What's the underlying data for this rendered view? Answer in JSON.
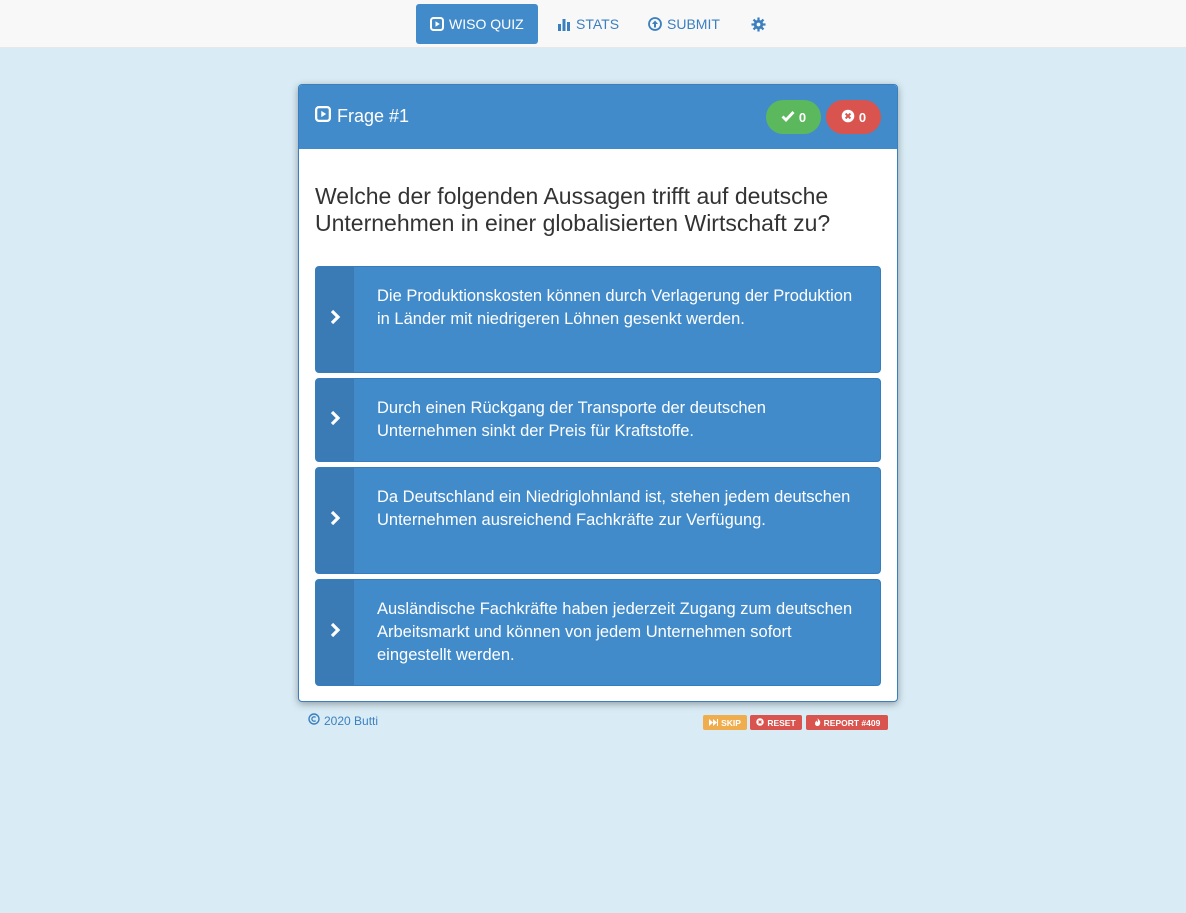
{
  "nav": {
    "quiz_label": "WISO QUIZ",
    "stats_label": "STATS",
    "submit_label": "SUBMIT"
  },
  "panel": {
    "title": "Frage #1",
    "correct_count": "0",
    "wrong_count": "0"
  },
  "question": {
    "text": "Welche der folgenden Aussagen trifft auf deutsche Unternehmen in einer globalisierten Wirtschaft zu?"
  },
  "answers": [
    {
      "text": "Die Produktionskosten können durch Verlagerung der Produktion in Länder mit niedrigeren Löhnen gesenkt werden."
    },
    {
      "text": "Durch einen Rückgang der Transporte der deutschen Unternehmen sinkt der Preis für Kraftstoffe."
    },
    {
      "text": "Da Deutschland ein Niedriglohnland ist, stehen jedem deutschen Unternehmen ausreichend Fachkräfte zur Verfügung."
    },
    {
      "text": "Ausländische Fachkräfte haben jederzeit Zugang zum deutschen Arbeitsmarkt und können von jedem Unternehmen sofort eingestellt werden."
    }
  ],
  "footer": {
    "copyright": "2020 Butti",
    "skip_label": "SKIP",
    "reset_label": "RESET",
    "report_label": "REPORT #409"
  },
  "colors": {
    "primary": "#428bca",
    "success": "#5cb85c",
    "danger": "#d9534f",
    "warning": "#f0ad4e",
    "background": "#d9ecf6"
  }
}
